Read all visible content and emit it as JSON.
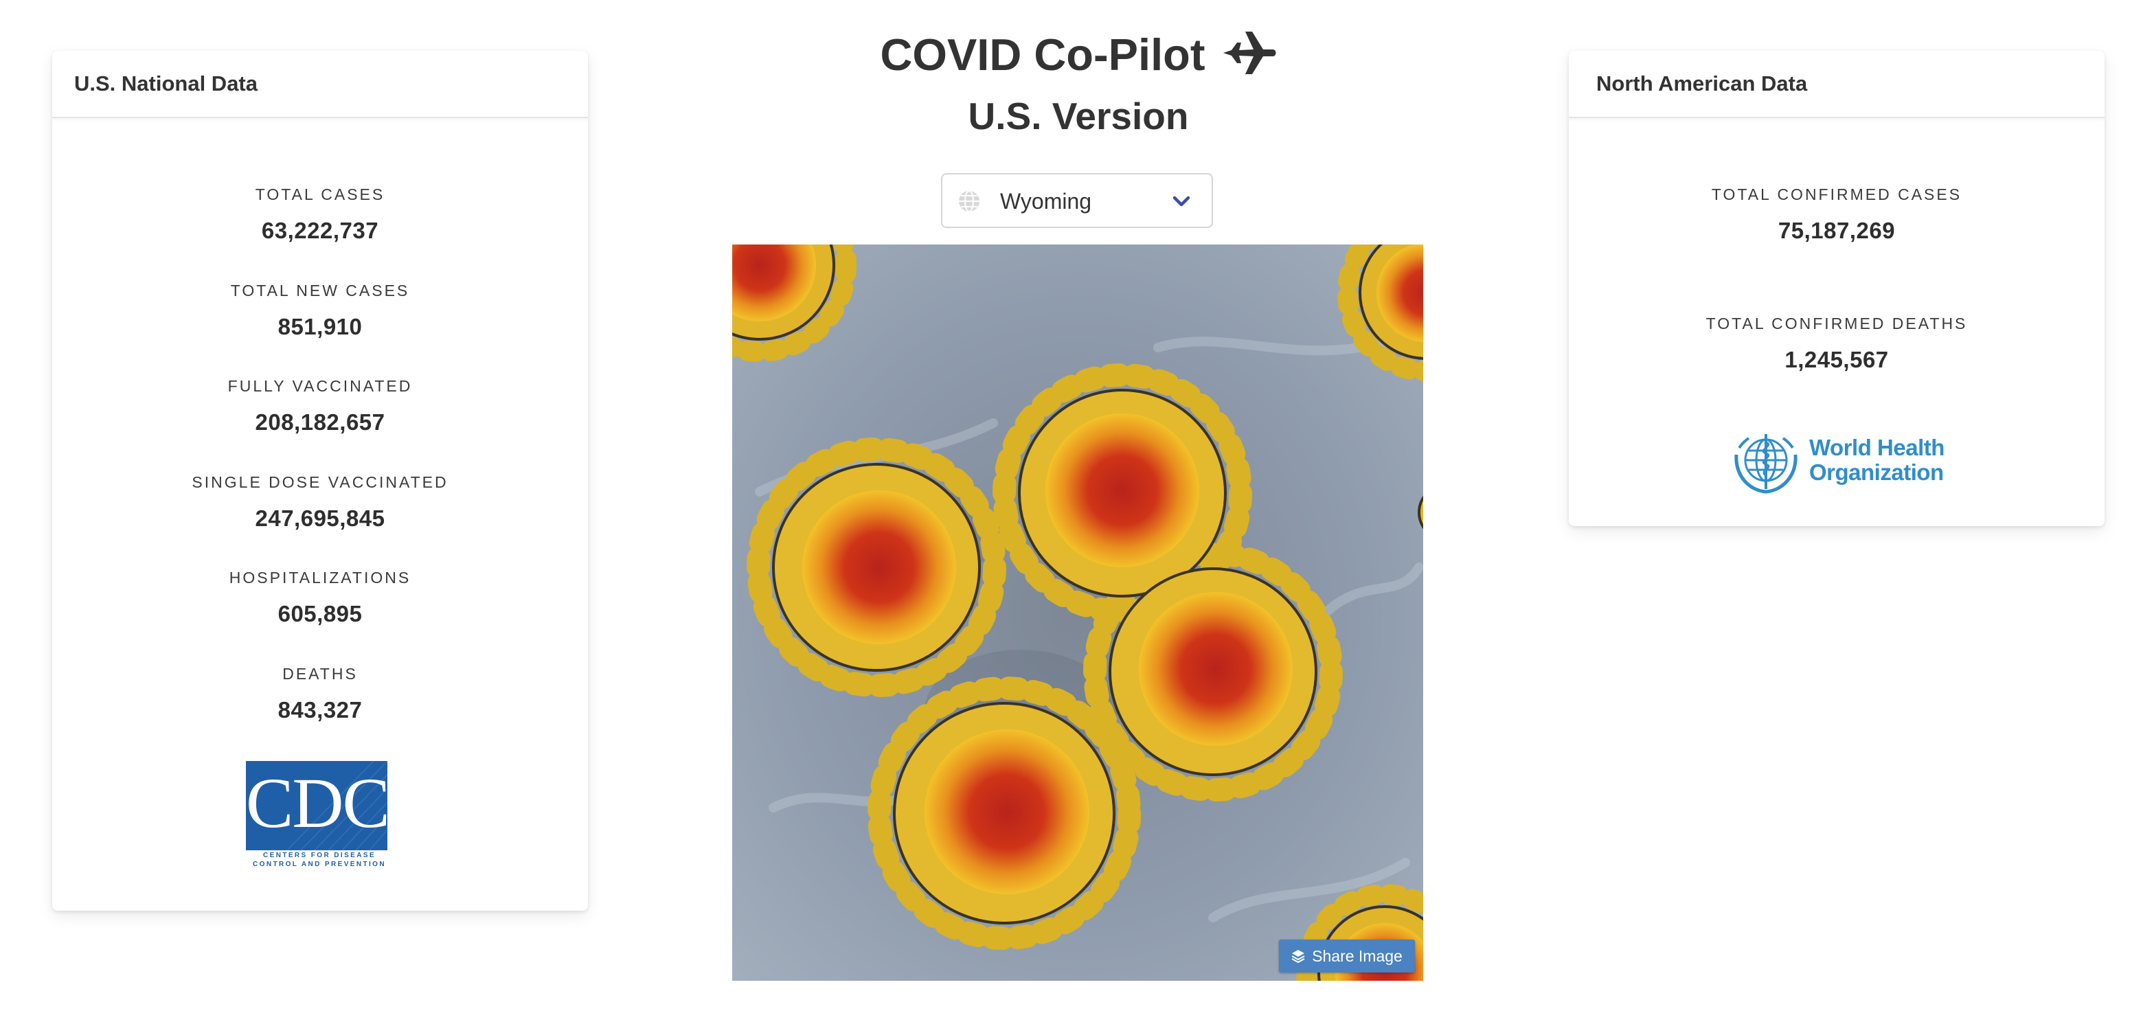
{
  "header": {
    "title": "COVID Co-Pilot",
    "subtitle": "U.S. Version",
    "title_icon": "airplane-icon"
  },
  "state_select": {
    "selected": "Wyoming",
    "icon": "globe-icon"
  },
  "hero": {
    "share_button_label": "Share Image",
    "share_icon": "layers-icon"
  },
  "us_card": {
    "title": "U.S. National Data",
    "stats": [
      {
        "label": "TOTAL CASES",
        "value": "63,222,737"
      },
      {
        "label": "TOTAL NEW CASES",
        "value": "851,910"
      },
      {
        "label": "FULLY VACCINATED",
        "value": "208,182,657"
      },
      {
        "label": "SINGLE DOSE VACCINATED",
        "value": "247,695,845"
      },
      {
        "label": "HOSPITALIZATIONS",
        "value": "605,895"
      },
      {
        "label": "DEATHS",
        "value": "843,327"
      }
    ],
    "logo": {
      "text": "CDC",
      "line1": "CENTERS FOR DISEASE",
      "line2": "CONTROL AND PREVENTION"
    }
  },
  "na_card": {
    "title": "North American Data",
    "stats": [
      {
        "label": "TOTAL CONFIRMED CASES",
        "value": "75,187,269"
      },
      {
        "label": "TOTAL CONFIRMED DEATHS",
        "value": "1,245,567"
      }
    ],
    "logo": {
      "line1": "World Health",
      "line2": "Organization"
    }
  },
  "colors": {
    "accent_blue": "#4a82c2",
    "cdc_blue": "#1f5fa8",
    "who_blue": "#2f8dcc",
    "chevron": "#3b4ea6"
  }
}
